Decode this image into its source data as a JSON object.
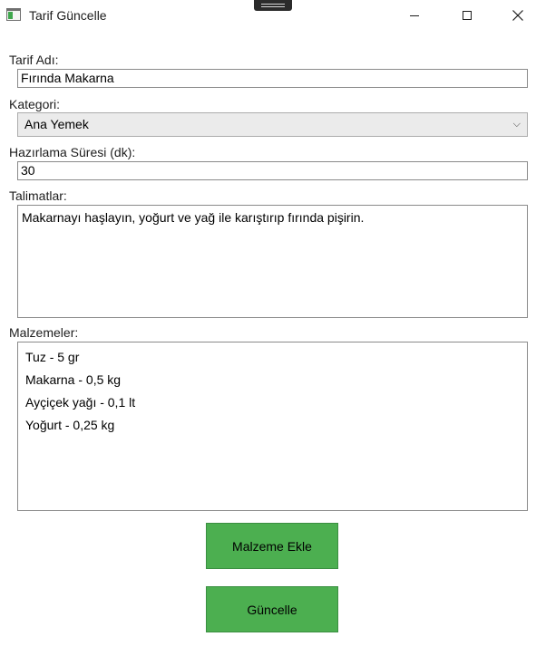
{
  "window": {
    "title": "Tarif Güncelle",
    "icon": "app-window-icon"
  },
  "form": {
    "name_label": "Tarif Adı:",
    "name_value": "Fırında Makarna",
    "category_label": "Kategori:",
    "category_value": "Ana Yemek",
    "prep_label": "Hazırlama Süresi (dk):",
    "prep_value": "30",
    "instructions_label": "Talimatlar:",
    "instructions_value": "Makarnayı haşlayın, yoğurt ve yağ ile karıştırıp fırında pişirin.",
    "ingredients_label": "Malzemeler:",
    "ingredients": [
      "Tuz - 5 gr",
      "Makarna - 0,5 kg",
      "Ayçiçek yağı - 0,1 lt",
      "Yoğurt - 0,25 kg"
    ]
  },
  "buttons": {
    "add_ingredient": "Malzeme Ekle",
    "update": "Güncelle"
  },
  "colors": {
    "button_green": "#4caf50"
  }
}
